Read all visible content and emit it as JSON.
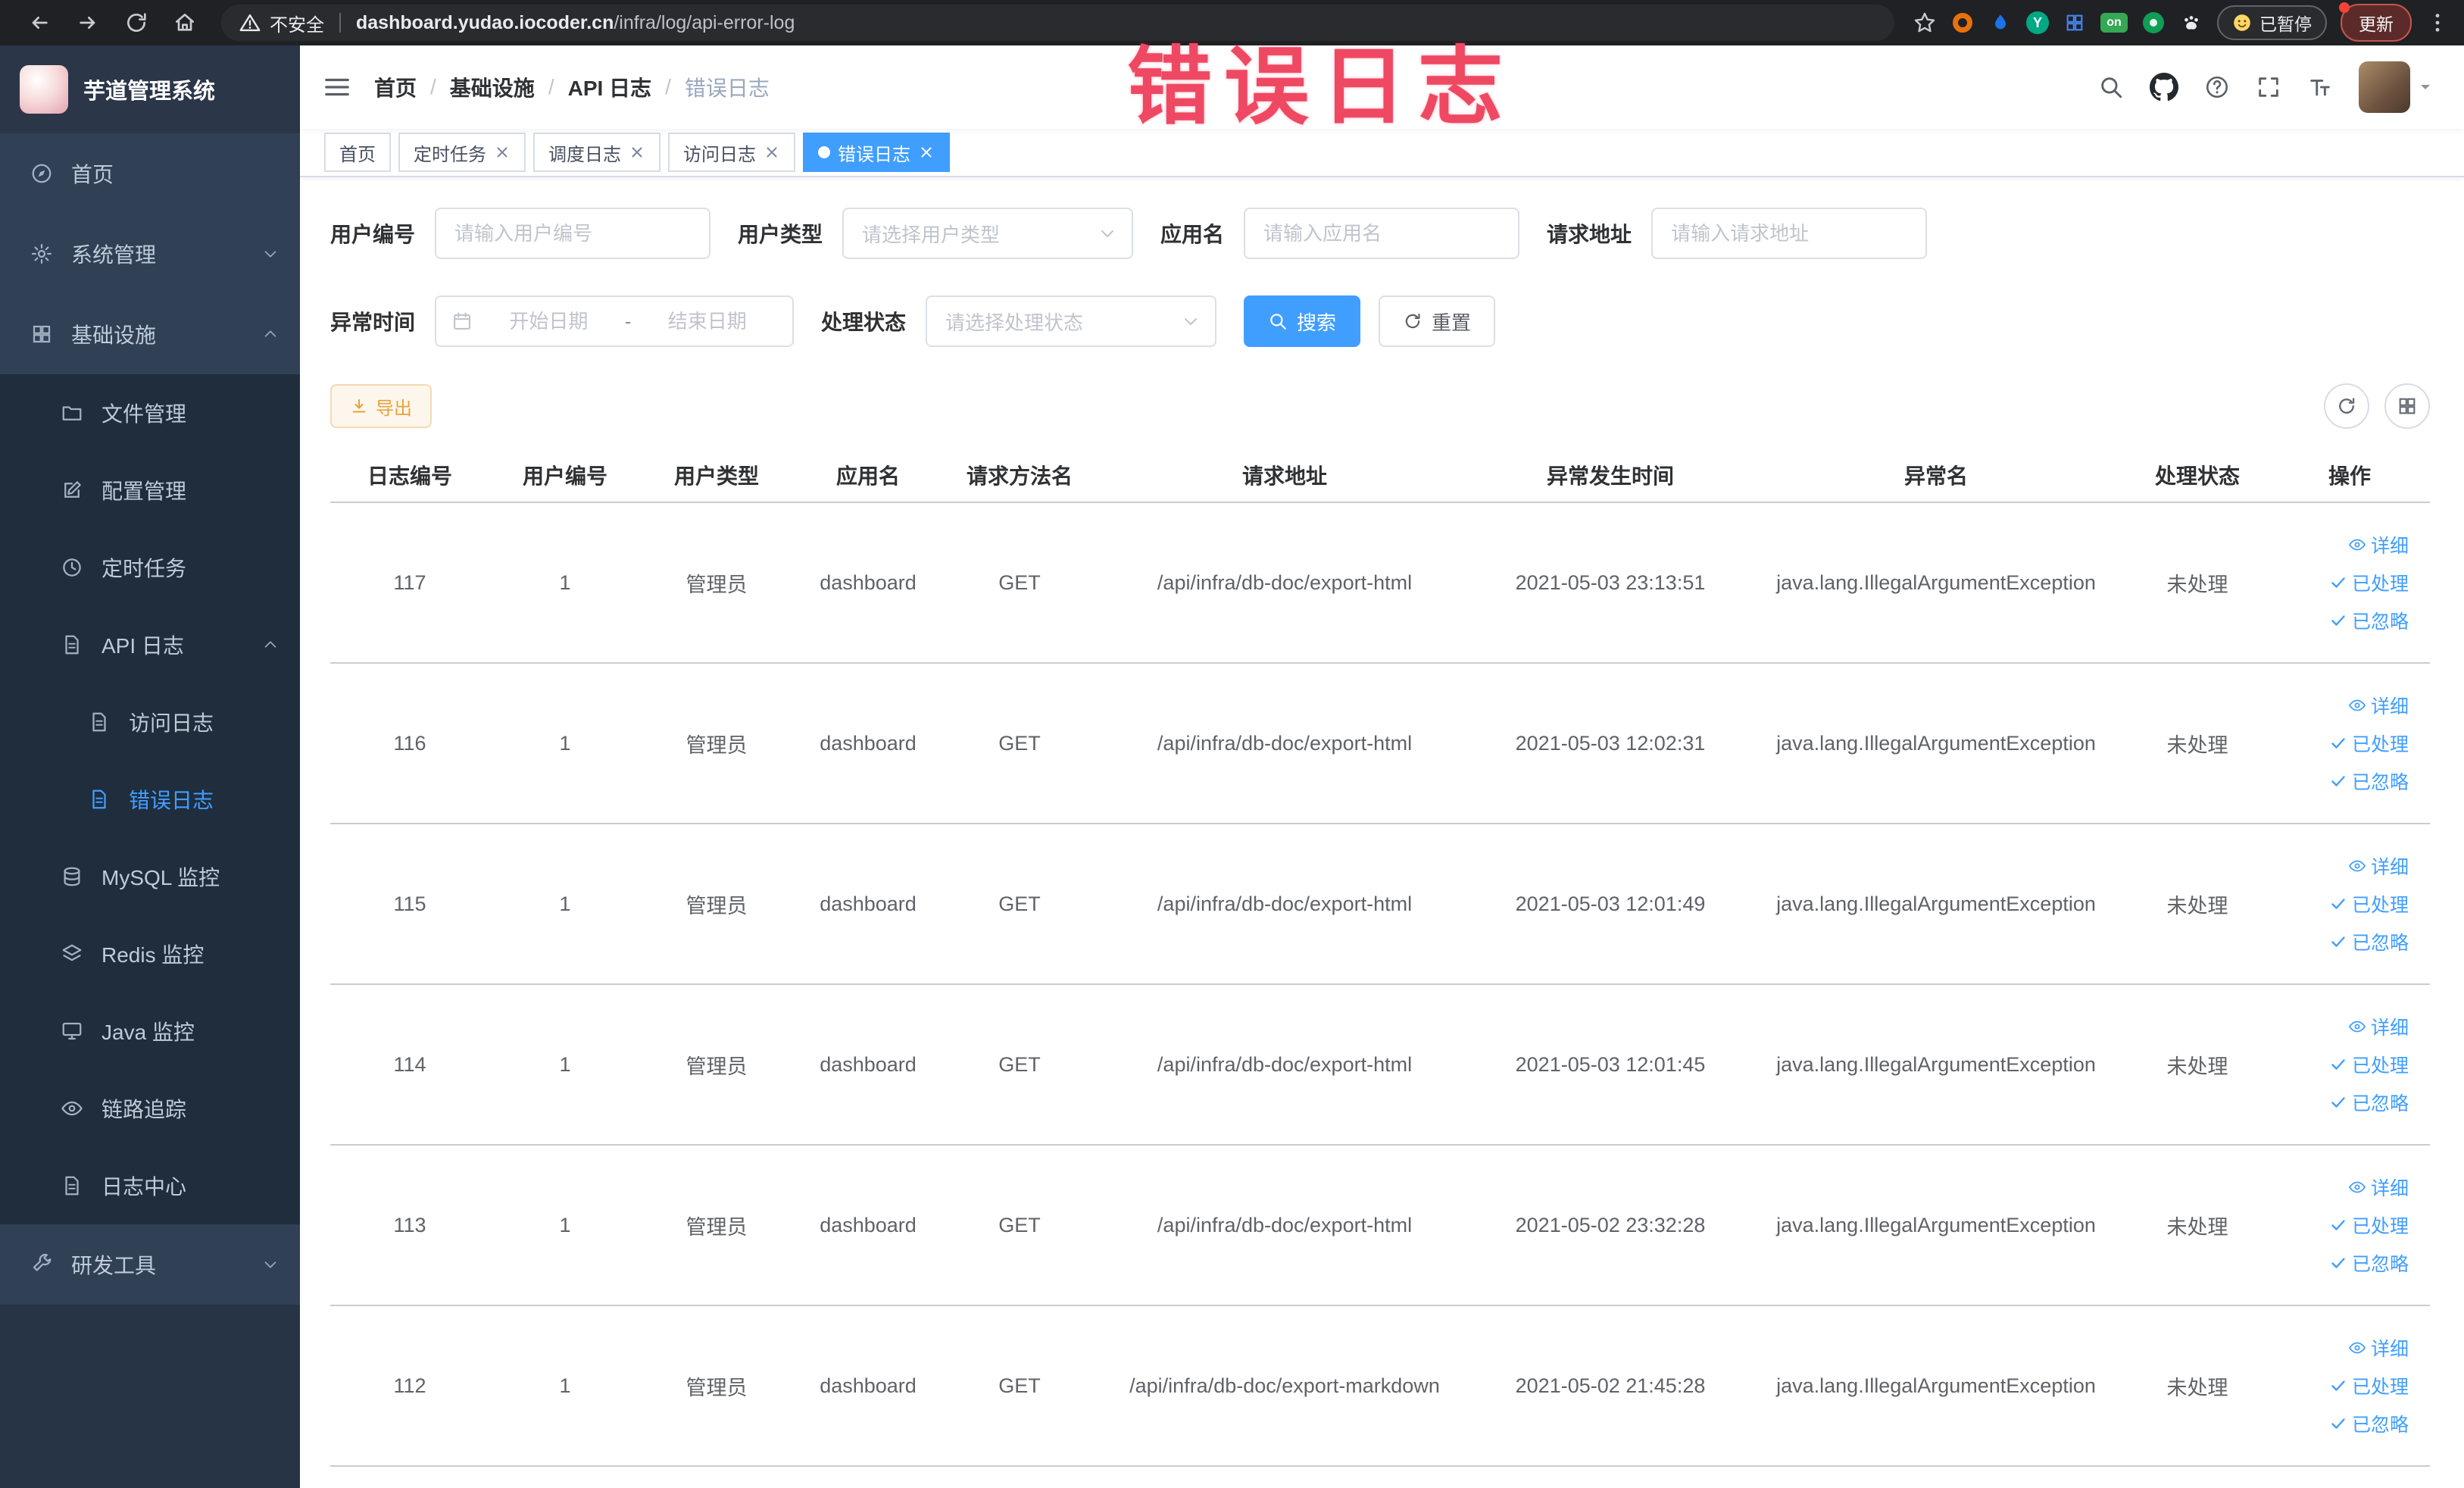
{
  "browser": {
    "security_label": "不安全",
    "url_domain": "dashboard.yudao.iocoder.cn",
    "url_path": "/infra/log/api-error-log",
    "ext_on": "on",
    "ext_y": "Y",
    "paused_badge": "已暂停",
    "update_button": "更新"
  },
  "overlay_text": "错误日志",
  "sidebar": {
    "title": "芋道管理系统",
    "items": [
      {
        "label": "首页"
      },
      {
        "label": "系统管理"
      },
      {
        "label": "基础设施"
      },
      {
        "label": "文件管理"
      },
      {
        "label": "配置管理"
      },
      {
        "label": "定时任务"
      },
      {
        "label": "API 日志"
      },
      {
        "label": "访问日志"
      },
      {
        "label": "错误日志"
      },
      {
        "label": "MySQL 监控"
      },
      {
        "label": "Redis 监控"
      },
      {
        "label": "Java 监控"
      },
      {
        "label": "链路追踪"
      },
      {
        "label": "日志中心"
      },
      {
        "label": "研发工具"
      }
    ]
  },
  "breadcrumb": [
    "首页",
    "基础设施",
    "API 日志",
    "错误日志"
  ],
  "tabs": [
    {
      "label": "首页"
    },
    {
      "label": "定时任务"
    },
    {
      "label": "调度日志"
    },
    {
      "label": "访问日志"
    },
    {
      "label": "错误日志"
    }
  ],
  "filters": {
    "user_id_label": "用户编号",
    "user_id_placeholder": "请输入用户编号",
    "user_type_label": "用户类型",
    "user_type_placeholder": "请选择用户类型",
    "app_name_label": "应用名",
    "app_name_placeholder": "请输入应用名",
    "request_url_label": "请求地址",
    "request_url_placeholder": "请输入请求地址",
    "exception_time_label": "异常时间",
    "date_start_placeholder": "开始日期",
    "date_separator": "-",
    "date_end_placeholder": "结束日期",
    "process_status_label": "处理状态",
    "process_status_placeholder": "请选择处理状态",
    "search_button": "搜索",
    "reset_button": "重置"
  },
  "toolbar": {
    "export_button": "导出"
  },
  "table": {
    "columns": [
      "日志编号",
      "用户编号",
      "用户类型",
      "应用名",
      "请求方法名",
      "请求地址",
      "异常发生时间",
      "异常名",
      "处理状态",
      "操作"
    ],
    "action_detail": "详细",
    "action_processed": "已处理",
    "action_ignored": "已忽略",
    "rows": [
      {
        "id": "117",
        "user_id": "1",
        "user_type": "管理员",
        "app_name": "dashboard",
        "method": "GET",
        "url": "/api/infra/db-doc/export-html",
        "time": "2021-05-03 23:13:51",
        "exception": "java.lang.IllegalArgumentException",
        "status": "未处理"
      },
      {
        "id": "116",
        "user_id": "1",
        "user_type": "管理员",
        "app_name": "dashboard",
        "method": "GET",
        "url": "/api/infra/db-doc/export-html",
        "time": "2021-05-03 12:02:31",
        "exception": "java.lang.IllegalArgumentException",
        "status": "未处理"
      },
      {
        "id": "115",
        "user_id": "1",
        "user_type": "管理员",
        "app_name": "dashboard",
        "method": "GET",
        "url": "/api/infra/db-doc/export-html",
        "time": "2021-05-03 12:01:49",
        "exception": "java.lang.IllegalArgumentException",
        "status": "未处理"
      },
      {
        "id": "114",
        "user_id": "1",
        "user_type": "管理员",
        "app_name": "dashboard",
        "method": "GET",
        "url": "/api/infra/db-doc/export-html",
        "time": "2021-05-03 12:01:45",
        "exception": "java.lang.IllegalArgumentException",
        "status": "未处理"
      },
      {
        "id": "113",
        "user_id": "1",
        "user_type": "管理员",
        "app_name": "dashboard",
        "method": "GET",
        "url": "/api/infra/db-doc/export-html",
        "time": "2021-05-02 23:32:28",
        "exception": "java.lang.IllegalArgumentException",
        "status": "未处理"
      },
      {
        "id": "112",
        "user_id": "1",
        "user_type": "管理员",
        "app_name": "dashboard",
        "method": "GET",
        "url": "/api/infra/db-doc/export-markdown",
        "time": "2021-05-02 21:45:28",
        "exception": "java.lang.IllegalArgumentException",
        "status": "未处理"
      }
    ]
  },
  "colors": {
    "accent": "#409eff",
    "warning": "#e6a23c",
    "overlay": "#ef4863",
    "sidebar": "#304156"
  }
}
